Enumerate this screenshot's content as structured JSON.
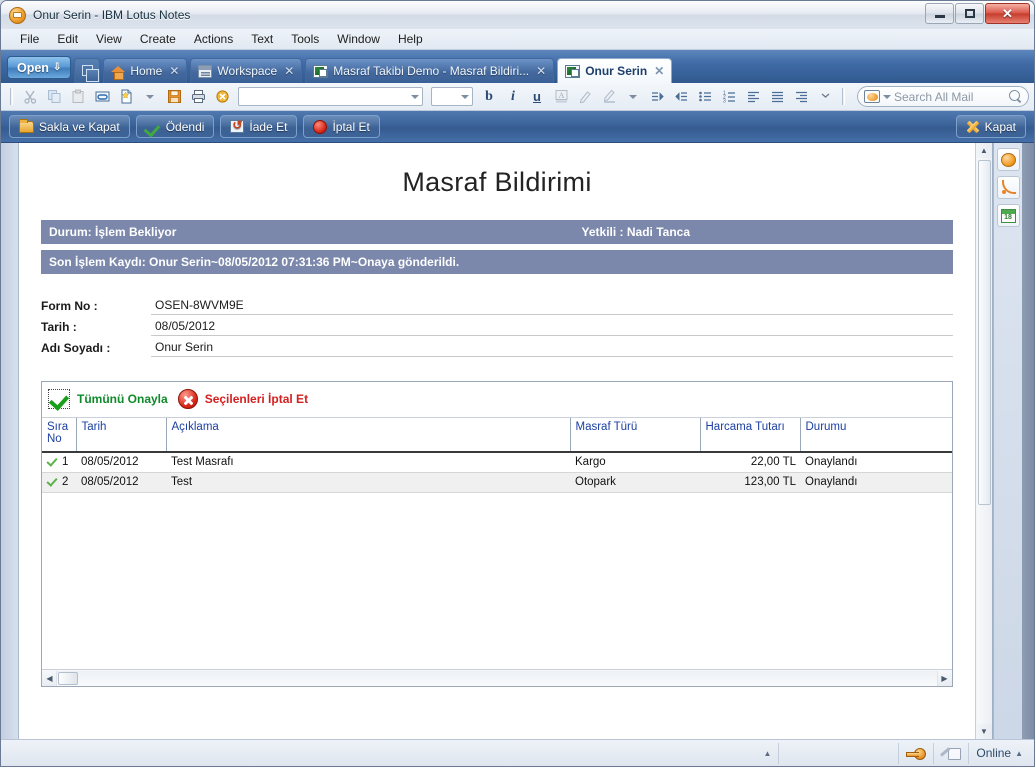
{
  "window": {
    "title": "Onur Serin - IBM Lotus Notes",
    "app_icon": "notes-app-icon",
    "minimize": "minimize-button",
    "restore": "restore-button",
    "close": "✕"
  },
  "menu": {
    "items": [
      "File",
      "Edit",
      "View",
      "Create",
      "Actions",
      "Text",
      "Tools",
      "Window",
      "Help"
    ]
  },
  "tabbar": {
    "open_label": "Open",
    "open_arrow": "⇩",
    "tabs": [
      {
        "label": "Home",
        "icon": "home-icon",
        "close": "✕",
        "active": false
      },
      {
        "label": "Workspace",
        "icon": "workspace-icon",
        "close": "✕",
        "active": false
      },
      {
        "label": "Masraf Takibi Demo - Masraf Bildiri...",
        "icon": "database-icon",
        "close": "✕",
        "active": false
      },
      {
        "label": "Onur Serin",
        "icon": "document-icon",
        "close": "✕",
        "active": true
      }
    ]
  },
  "formatbar": {
    "font_name": "",
    "font_size": "",
    "bold": "b",
    "italic": "i",
    "underline": "u",
    "icons": [
      "cut-icon",
      "copy-icon",
      "paste-icon",
      "link-icon",
      "new-document-icon",
      "save-icon",
      "print-icon",
      "cancel-icon"
    ]
  },
  "search": {
    "placeholder": "Search All Mail",
    "icon": "search-scope-icon",
    "magnifier": "search-icon"
  },
  "actionbar": {
    "buttons": [
      {
        "label": "Sakla ve Kapat",
        "icon": "save-close-icon"
      },
      {
        "label": "Ödendi",
        "icon": "paid-check-icon"
      },
      {
        "label": "İade Et",
        "icon": "return-icon"
      },
      {
        "label": "İptal Et",
        "icon": "cancel-stop-icon"
      }
    ],
    "close_label": "Kapat",
    "close_icon": "close-x-icon"
  },
  "document": {
    "title": "Masraf Bildirimi",
    "status_band": {
      "status_label": "Durum: İşlem Bekliyor",
      "authority_label": "Yetkili :  Nadi Tanca"
    },
    "history_band": {
      "text": "Son İşlem Kaydı: Onur Serin~08/05/2012 07:31:36 PM~Onaya gönderildi."
    },
    "band_color": "#7b88ab",
    "fields": [
      {
        "label": "Form No :",
        "value": "OSEN-8WVM9E"
      },
      {
        "label": "Tarih :",
        "value": "08/05/2012"
      },
      {
        "label": "Adı Soyadı :",
        "value": "Onur Serin"
      }
    ]
  },
  "embedded_view": {
    "actions": [
      {
        "label": "Tümünü Onayla",
        "icon": "approve-all-check-icon",
        "color": "#0f8a2a"
      },
      {
        "label": "Seçilenleri İptal Et",
        "icon": "cancel-selected-x-icon",
        "color": "#d42020"
      }
    ],
    "columns": [
      "Sıra No",
      "Tarih",
      "Açıklama",
      "Masraf Türü",
      "Harcama Tutarı",
      "Durumu"
    ],
    "rows": [
      {
        "seq": "1",
        "date": "08/05/2012",
        "description": "Test Masrafı",
        "type": "Kargo",
        "amount": "22,00 TL",
        "status": "Onaylandı"
      },
      {
        "seq": "2",
        "date": "08/05/2012",
        "description": "Test",
        "type": "Otopark",
        "amount": "123,00 TL",
        "status": "Onaylandı"
      }
    ],
    "status_color": "#c32020"
  },
  "sidebar": {
    "buttons": [
      {
        "icon": "sametime-chat-icon"
      },
      {
        "icon": "rss-feeds-icon"
      },
      {
        "icon": "calendar-icon",
        "label": "18"
      }
    ]
  },
  "statusbar": {
    "expand_arrow": "▲",
    "key_icon": "security-key-icon",
    "pen_icon": "edit-lock-icon",
    "online_label": "Online",
    "online_arrow": "▲"
  }
}
